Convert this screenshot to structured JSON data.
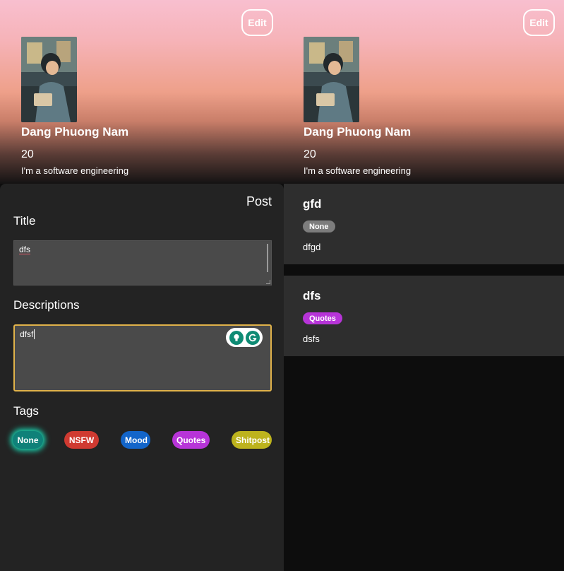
{
  "profile": {
    "name": "Dang Phuong Nam",
    "age": "20",
    "bio": "I'm a software engineering",
    "edit_label": "Edit",
    "avatar_icon": "avatar-illustration"
  },
  "composer": {
    "post_label": "Post",
    "title_label": "Title",
    "title_value": "dfs",
    "descriptions_label": "Descriptions",
    "description_value": "dfsf",
    "tags_label": "Tags",
    "tags": [
      {
        "label": "None",
        "color": "#0f8179",
        "selected": true
      },
      {
        "label": "NSFW",
        "color": "#cf3a31"
      },
      {
        "label": "Mood",
        "color": "#1365c9"
      },
      {
        "label": "Quotes",
        "color": "#b734d8"
      },
      {
        "label": "Shitpost",
        "color": "#bdb31d"
      }
    ]
  },
  "posts": [
    {
      "title": "gfd",
      "tag": "None",
      "tag_color": "#7d7d7d",
      "body": "dfgd"
    },
    {
      "title": "dfs",
      "tag": "Quotes",
      "tag_color": "#b734d8",
      "body": "dsfs"
    }
  ]
}
